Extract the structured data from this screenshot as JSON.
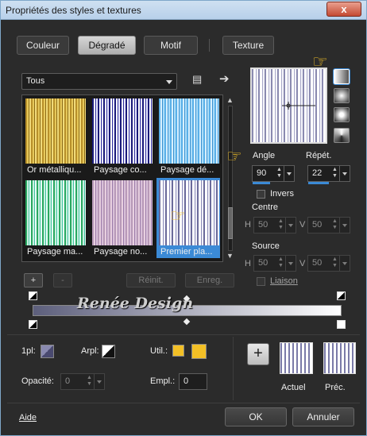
{
  "window": {
    "title": "Propriétés des styles et textures",
    "close": "x"
  },
  "tabs": [
    {
      "label": "Couleur"
    },
    {
      "label": "Dégradé"
    },
    {
      "label": "Motif"
    },
    {
      "label": "Texture"
    }
  ],
  "gallery": {
    "category": "Tous",
    "items": [
      {
        "label": "Or métalliqu..."
      },
      {
        "label": "Paysage co..."
      },
      {
        "label": "Paysage dé..."
      },
      {
        "label": "Paysage ma..."
      },
      {
        "label": "Paysage no..."
      },
      {
        "label": "Premier pla..."
      }
    ]
  },
  "buttons": {
    "add": "+",
    "remove": "-",
    "reset": "Réinit.",
    "save": "Enreg.",
    "ok": "OK",
    "cancel": "Annuler",
    "help": "Aide"
  },
  "settings": {
    "angle_label": "Angle",
    "angle": "90",
    "repeat_label": "Répét.",
    "repeat": "22",
    "invert_label": "Invers",
    "center_label": "Centre",
    "center_h": "50",
    "center_v": "50",
    "source_label": "Source",
    "source_h": "50",
    "source_v": "50",
    "link_label": "Liaison",
    "h": "H",
    "v": "V"
  },
  "watermark": "Renée Design",
  "bottom": {
    "1pl": "1pl:",
    "arpl": "Arpl:",
    "util": "Util.:",
    "opacity_label": "Opacité:",
    "opacity": "0",
    "empl_label": "Empl.:",
    "empl": "0",
    "current": "Actuel",
    "previous": "Préc."
  },
  "colors": {
    "accent": "#3b8ad6",
    "gold": "#f3c026"
  }
}
